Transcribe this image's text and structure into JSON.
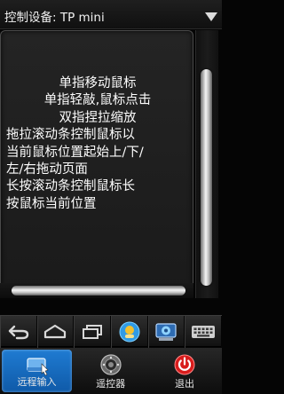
{
  "header": {
    "title": "控制设备: TP mini"
  },
  "touchpad": {
    "instructions": {
      "line1": "单指移动鼠标",
      "line2": "单指轻敲,鼠标点击",
      "line3": "双指捏拉缩放",
      "line4": "拖拉滚动条控制鼠标以",
      "line5": "当前鼠标位置起始上/下/",
      "line6": "左/右拖动页面",
      "line7": "长按滚动条控制鼠标长",
      "line8": "按鼠标当前位置"
    }
  },
  "toolbar": {
    "icons": [
      "back-icon",
      "home-icon",
      "recent-apps-icon",
      "app-badge-icon",
      "system-settings-icon",
      "keyboard-icon"
    ]
  },
  "bottom_nav": {
    "items": [
      {
        "label": "远程输入",
        "icon": "touchpad-icon",
        "active": true
      },
      {
        "label": "遥控器",
        "icon": "remote-icon",
        "active": false
      },
      {
        "label": "退出",
        "icon": "power-icon",
        "active": false
      }
    ]
  },
  "colors": {
    "accent": "#1a6fc4",
    "exit_red": "#d81c1c"
  }
}
